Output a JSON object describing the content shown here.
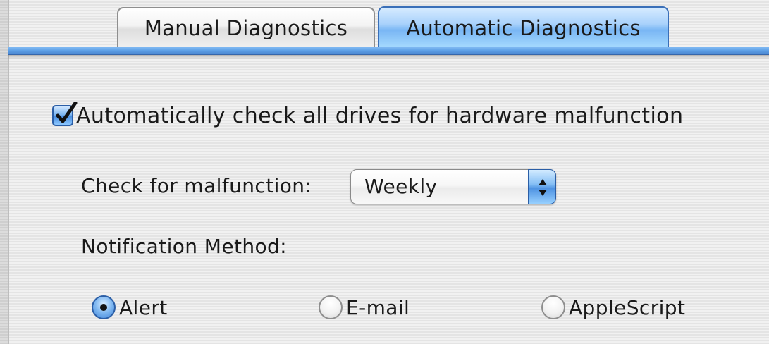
{
  "tabs": [
    {
      "label": "Manual Diagnostics",
      "selected": false
    },
    {
      "label": "Automatic Diagnostics",
      "selected": true
    }
  ],
  "auto_check": {
    "label": "Automatically check all drives for hardware malfunction",
    "checked": true
  },
  "frequency": {
    "label": "Check for malfunction:",
    "selected": "Weekly"
  },
  "notification": {
    "label": "Notification Method:",
    "options": [
      {
        "label": "Alert",
        "selected": true
      },
      {
        "label": "E-mail",
        "selected": false
      },
      {
        "label": "AppleScript",
        "selected": false
      }
    ]
  },
  "colors": {
    "accent": "#4b8fe0",
    "accent_border": "#2b5ea6"
  }
}
